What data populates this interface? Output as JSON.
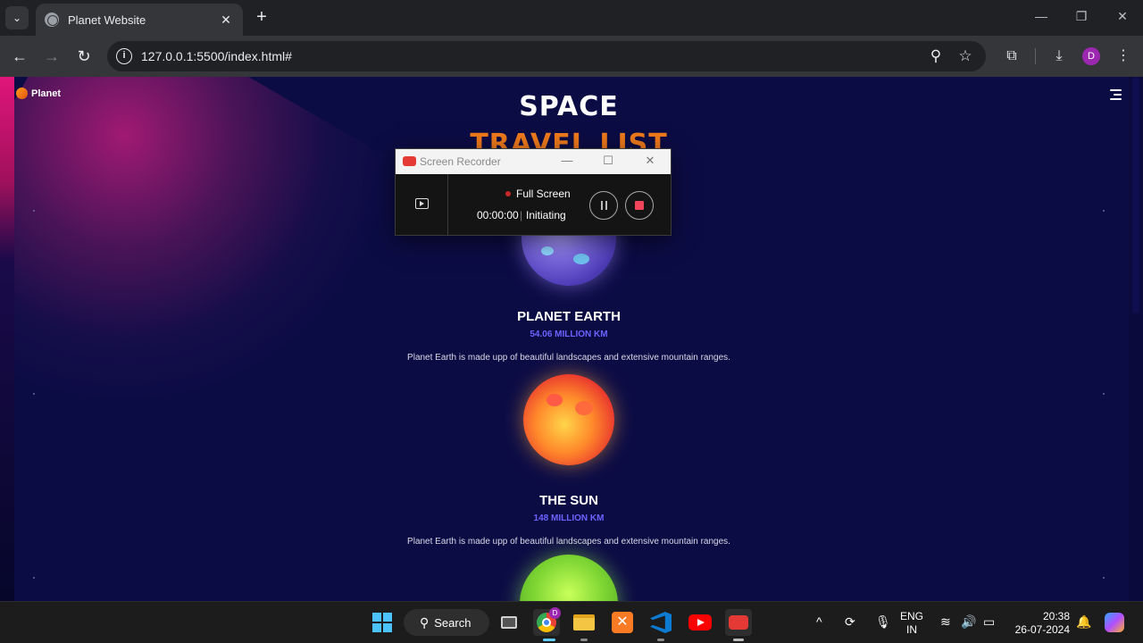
{
  "browser": {
    "tab_title": "Planet Website",
    "tab_close": "✕",
    "new_tab": "+",
    "url": "127.0.0.1:5500/index.html#",
    "profile_initial": "D"
  },
  "site": {
    "logo_text": "Planet",
    "title_line1": "SPACE",
    "title_line2": "TRAVEL LIST",
    "planets": [
      {
        "name": "PLANET EARTH",
        "distance": "54.06 MILLION KM",
        "description": "Planet Earth is made upp of beautiful landscapes and extensive mountain ranges."
      },
      {
        "name": "THE SUN",
        "distance": "148 MILLION KM",
        "description": "Planet Earth is made upp of beautiful landscapes and extensive mountain ranges."
      }
    ]
  },
  "recorder": {
    "title": "Screen Recorder",
    "mode": "Full Screen",
    "timer": "00:00:00",
    "separator": "|",
    "status": "Initiating",
    "accent_color": "#f0455a"
  },
  "taskbar": {
    "search_label": "Search",
    "chrome_badge": "D",
    "lang_line1": "ENG",
    "lang_line2": "IN",
    "time": "20:38",
    "date": "26-07-2024"
  },
  "colors": {
    "page_bg": "#0c0c45",
    "title_orange": "#ef7a1c",
    "distance_purple": "#6b63ff"
  }
}
